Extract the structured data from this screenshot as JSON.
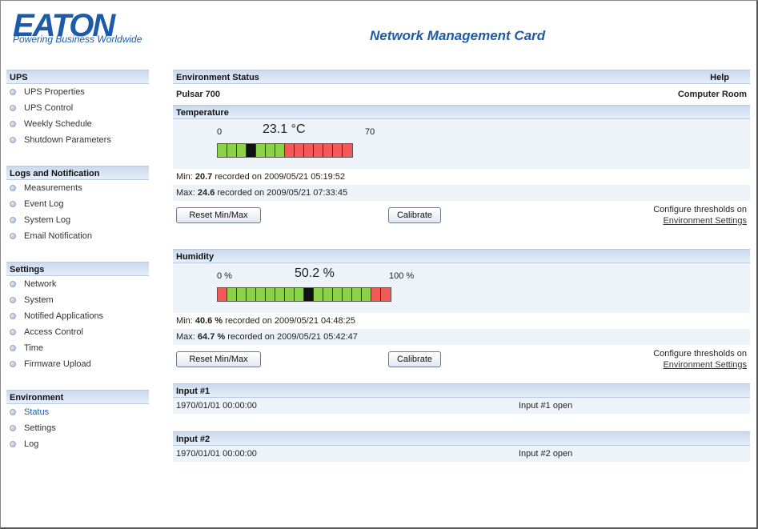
{
  "header": {
    "logo_text": "EATON",
    "tagline": "Powering Business Worldwide",
    "title": "Network Management Card"
  },
  "sidebar": {
    "sections": [
      {
        "title": "UPS",
        "items": [
          "UPS Properties",
          "UPS Control",
          "Weekly Schedule",
          "Shutdown Parameters"
        ]
      },
      {
        "title": "Logs and Notification",
        "items": [
          "Measurements",
          "Event Log",
          "System Log",
          "Email Notification"
        ]
      },
      {
        "title": "Settings",
        "items": [
          "Network",
          "System",
          "Notified Applications",
          "Access Control",
          "Time",
          "Firmware Upload"
        ]
      },
      {
        "title": "Environment",
        "items": [
          "Status",
          "Settings",
          "Log"
        ],
        "active": "Status"
      }
    ]
  },
  "main": {
    "status_title": "Environment Status",
    "help_label": "Help",
    "device_name": "Pulsar 700",
    "location": "Computer Room",
    "temperature": {
      "title": "Temperature",
      "min_label": "0",
      "value": "23.1 °C",
      "max_label": "70",
      "segments": [
        "g",
        "g",
        "g",
        "k",
        "g",
        "g",
        "g",
        "r",
        "r",
        "r",
        "r",
        "r",
        "r",
        "r"
      ],
      "min_prefix": "Min:",
      "min_value": "20.7",
      "min_text": "recorded on 2009/05/21 05:19:52",
      "max_prefix": "Max:",
      "max_value": "24.6",
      "max_text": "recorded on 2009/05/21 07:33:45",
      "reset_label": "Reset Min/Max",
      "calibrate_label": "Calibrate",
      "cfg_text": "Configure thresholds on",
      "cfg_link": "Environment Settings"
    },
    "humidity": {
      "title": "Humidity",
      "min_label": "0 %",
      "value": "50.2 %",
      "max_label": "100 %",
      "segments": [
        "r",
        "g",
        "g",
        "g",
        "g",
        "g",
        "g",
        "g",
        "g",
        "k",
        "g",
        "g",
        "g",
        "g",
        "g",
        "g",
        "r",
        "r"
      ],
      "min_prefix": "Min:",
      "min_value": "40.6 %",
      "min_text": "recorded on 2009/05/21 04:48:25",
      "max_prefix": "Max:",
      "max_value": "64.7 %",
      "max_text": "recorded on 2009/05/21 05:42:47",
      "reset_label": "Reset Min/Max",
      "calibrate_label": "Calibrate",
      "cfg_text": "Configure thresholds on",
      "cfg_link": "Environment Settings"
    },
    "input1": {
      "title": "Input #1",
      "timestamp": "1970/01/01 00:00:00",
      "state": "Input #1 open"
    },
    "input2": {
      "title": "Input #2",
      "timestamp": "1970/01/01 00:00:00",
      "state": "Input #2 open"
    }
  },
  "colors": {
    "brand": "#1d5aa8",
    "gauge_green": "#8cd14a",
    "gauge_red": "#f25a5a",
    "gauge_marker": "#111111"
  }
}
